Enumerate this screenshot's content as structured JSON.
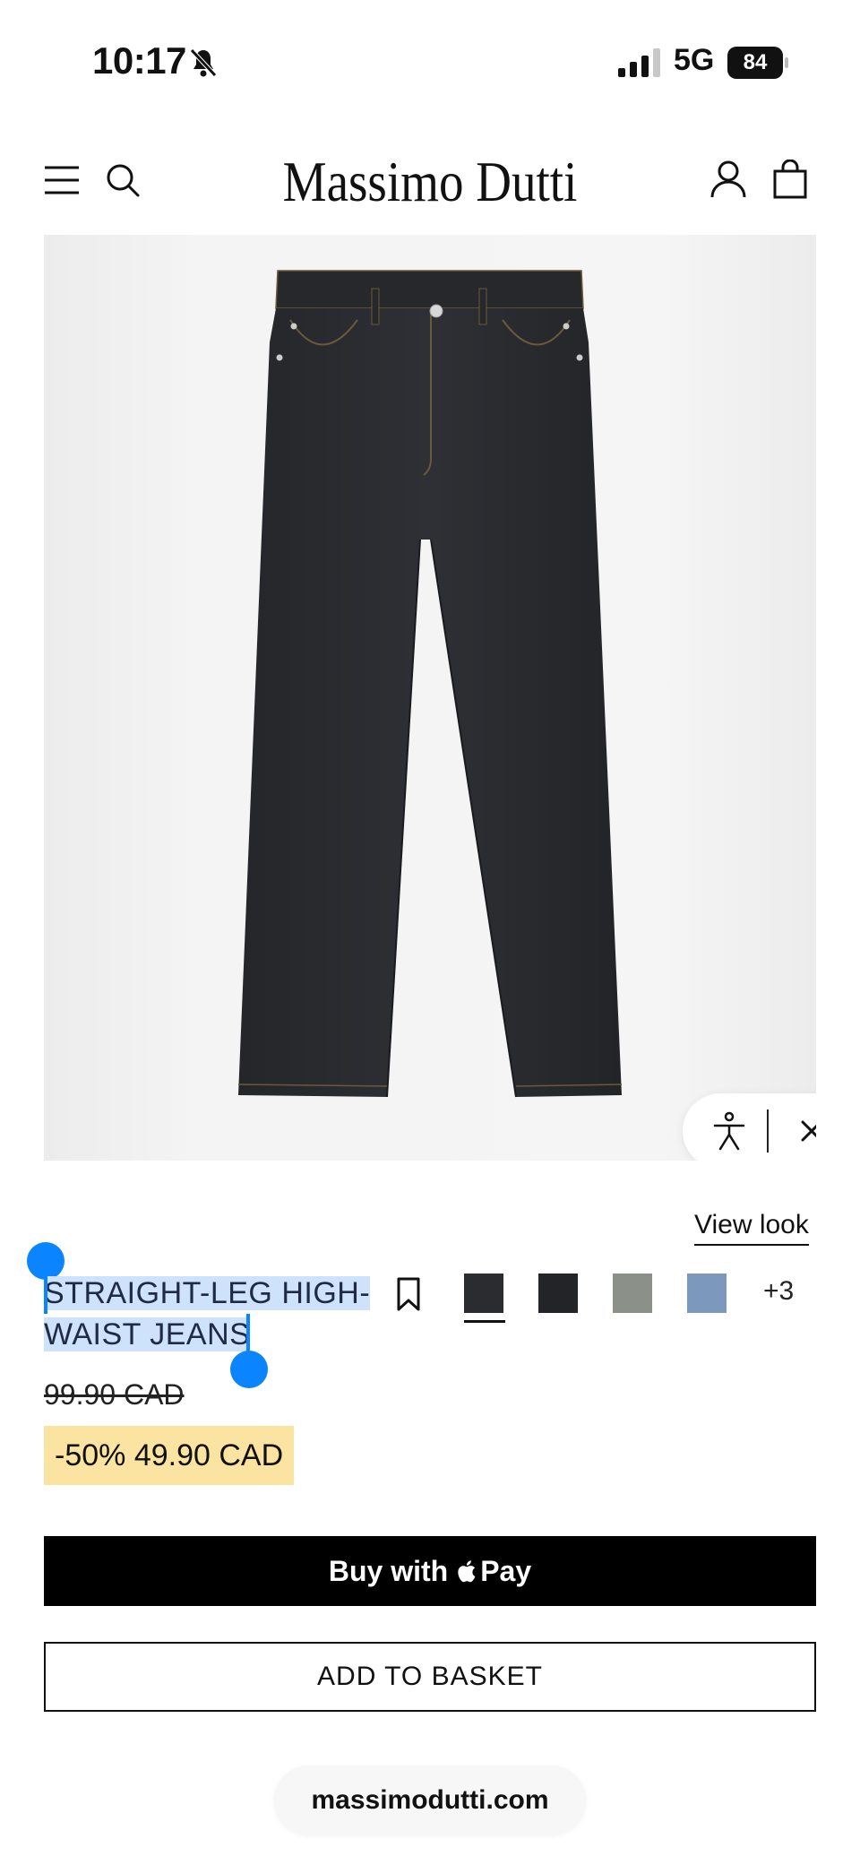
{
  "status_bar": {
    "time": "10:17",
    "network": "5G",
    "battery": "84",
    "icons": [
      "bell-slash-icon",
      "signal-icon",
      "battery-icon"
    ]
  },
  "header": {
    "brand": "Massimo Dutti",
    "icons": [
      "menu-icon",
      "search-icon",
      "account-icon",
      "bag-icon"
    ]
  },
  "product": {
    "image_alt_icon": "jeans-product-image",
    "fit_pill_icons": [
      "person-icon",
      "close-icon"
    ],
    "view_look": "View look",
    "title": "STRAIGHT-LEG HIGH-WAIST JEANS",
    "colors": [
      {
        "name": "dark-rinse",
        "hex": "#2a2c30",
        "selected": true
      },
      {
        "name": "black",
        "hex": "#232427",
        "selected": false
      },
      {
        "name": "grey",
        "hex": "#8b9088",
        "selected": false
      },
      {
        "name": "light-blue",
        "hex": "#7c98bd",
        "selected": false
      }
    ],
    "more_colors": "+3",
    "old_price": "99.90 CAD",
    "sale_price": "-50% 49.90 CAD"
  },
  "actions": {
    "apple_pay_prefix": "Buy with",
    "apple_pay_word": "Pay",
    "add_to_basket": "ADD TO BASKET"
  },
  "browser": {
    "url": "massimodutti.com"
  },
  "colors": {
    "selection_highlight": "#cfe2fb",
    "selection_handle": "#0a84ff",
    "sale_badge": "#fbe3a1"
  }
}
